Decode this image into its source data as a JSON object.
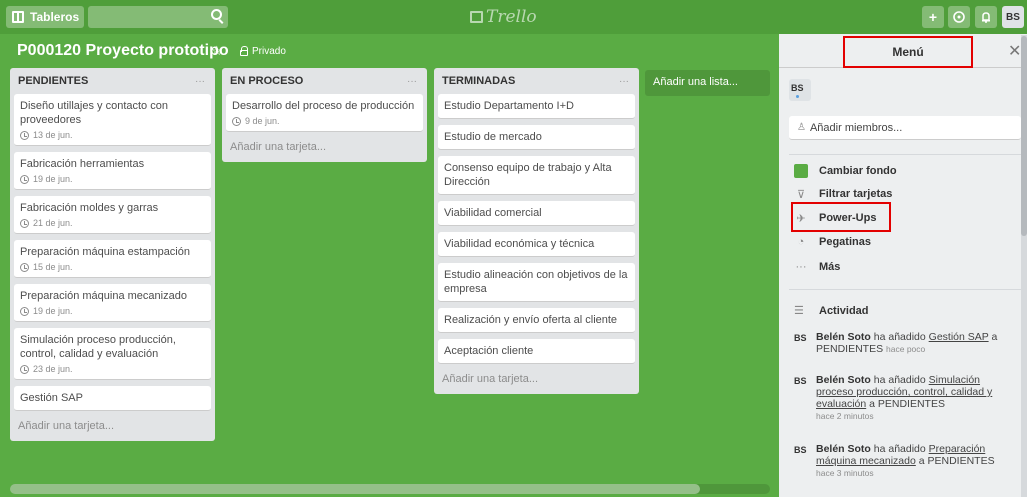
{
  "topbar": {
    "boards_label": "Tableros",
    "logo_text": "Trello",
    "create_glyph": "+",
    "info_glyph": "⓪",
    "notif_glyph": "🔔",
    "avatar_initials": "BS"
  },
  "board": {
    "title": "P000120 Proyecto prototipo",
    "star_glyph": "☆",
    "visibility": "Privado"
  },
  "lists": [
    {
      "title": "PENDIENTES",
      "cards": [
        {
          "title": "Diseño utillajes y contacto con proveedores",
          "date": "13 de jun."
        },
        {
          "title": "Fabricación herramientas",
          "date": "19 de jun."
        },
        {
          "title": "Fabricación moldes y garras",
          "date": "21 de jun."
        },
        {
          "title": "Preparación máquina estampación",
          "date": "15 de jun."
        },
        {
          "title": "Preparación máquina mecanizado",
          "date": "19 de jun."
        },
        {
          "title": "Simulación proceso producción, control, calidad y evaluación",
          "date": "23 de jun."
        },
        {
          "title": "Gestión SAP",
          "date": ""
        }
      ],
      "add_card": "Añadir una tarjeta..."
    },
    {
      "title": "EN PROCESO",
      "cards": [
        {
          "title": "Desarrollo del proceso de producción",
          "date": "9 de jun."
        }
      ],
      "add_card": "Añadir una tarjeta..."
    },
    {
      "title": "TERMINADAS",
      "cards": [
        {
          "title": "Estudio Departamento I+D",
          "date": ""
        },
        {
          "title": "Estudio de mercado",
          "date": ""
        },
        {
          "title": "Consenso equipo de trabajo y Alta Dirección",
          "date": ""
        },
        {
          "title": "Viabilidad comercial",
          "date": ""
        },
        {
          "title": "Viabilidad económica y técnica",
          "date": ""
        },
        {
          "title": "Estudio alineación con objetivos de la empresa",
          "date": ""
        },
        {
          "title": "Realización y envío oferta al cliente",
          "date": ""
        },
        {
          "title": "Aceptación cliente",
          "date": ""
        }
      ],
      "add_card": "Añadir una tarjeta..."
    }
  ],
  "add_list": "Añadir una lista...",
  "list_menu_glyph": "···",
  "menu": {
    "title": "Menú",
    "close_glyph": "✕",
    "member_initials": "BS",
    "add_members": "Añadir miembros...",
    "items": {
      "change_background": "Cambiar fondo",
      "filter_cards": "Filtrar tarjetas",
      "power_ups": "Power-Ups",
      "stickers": "Pegatinas",
      "more": "Más"
    },
    "icons": {
      "filter": "⊽",
      "power_ups": "✈",
      "stickers": "◔",
      "more": "···",
      "activity": "☰",
      "person": "♙"
    },
    "activity_title": "Actividad",
    "activity": [
      {
        "initials": "BS",
        "user": "Belén Soto",
        "action": " ha añadido ",
        "card": "Gestión SAP",
        "target": " a PENDIENTES",
        "time": "hace poco"
      },
      {
        "initials": "BS",
        "user": "Belén Soto",
        "action": " ha añadido ",
        "card": "Simulación proceso producción, control, calidad y evaluación",
        "target": " a PENDIENTES",
        "time": "hace 2 minutos"
      },
      {
        "initials": "BS",
        "user": "Belén Soto",
        "action": " ha añadido ",
        "card": "Preparación máquina mecanizado",
        "target": " a PENDIENTES",
        "time": "hace 3 minutos"
      }
    ]
  },
  "colors": {
    "board_bg": "#5aac44",
    "topbar_bg": "#4f9e3a",
    "highlight": "#e30000"
  },
  "icon_names": [
    "boards-icon",
    "search-icon",
    "trello-logo-icon",
    "add-icon",
    "info-icon",
    "bell-icon",
    "star-icon",
    "lock-icon",
    "clock-icon",
    "close-icon",
    "filter-icon",
    "rocket-icon",
    "sticker-icon",
    "more-icon",
    "activity-icon",
    "person-icon"
  ]
}
